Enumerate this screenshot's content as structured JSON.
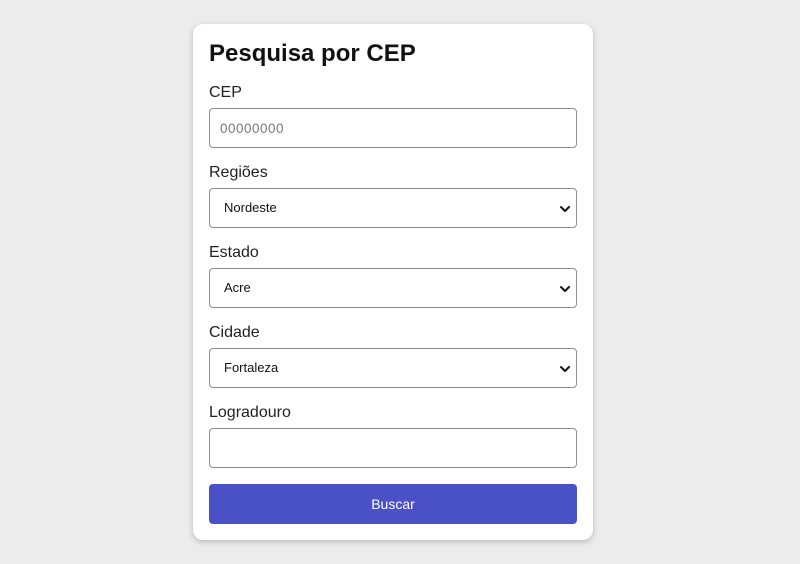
{
  "form": {
    "title": "Pesquisa por CEP",
    "cep": {
      "label": "CEP",
      "placeholder": "00000000",
      "value": ""
    },
    "regioes": {
      "label": "Regiões",
      "selected": "Nordeste"
    },
    "estado": {
      "label": "Estado",
      "selected": "Acre"
    },
    "cidade": {
      "label": "Cidade",
      "selected": "Fortaleza"
    },
    "logradouro": {
      "label": "Logradouro",
      "placeholder": "",
      "value": ""
    },
    "submit_label": "Buscar"
  },
  "icons": {
    "select_arrow": "chevron-down-icon"
  },
  "colors": {
    "background": "#ececec",
    "card": "#ffffff",
    "button": "#4a50c6",
    "button_text": "#ffffff"
  }
}
